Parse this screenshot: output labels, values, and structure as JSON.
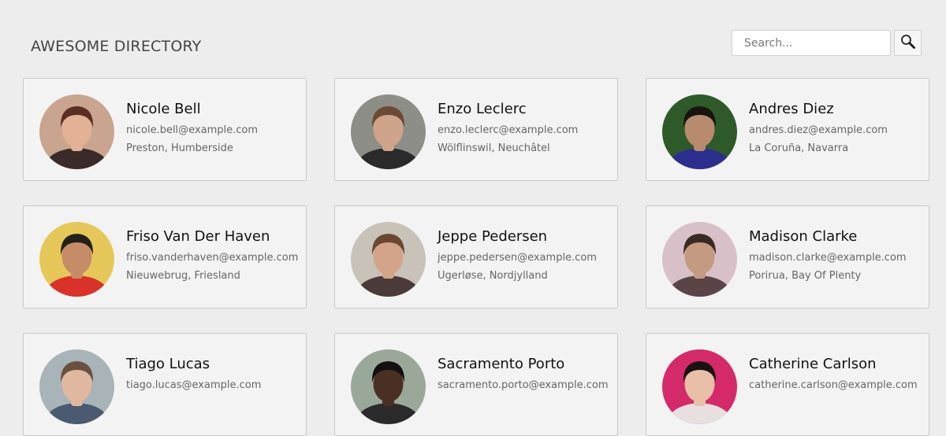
{
  "header": {
    "title": "AWESOME DIRECTORY"
  },
  "search": {
    "placeholder": "Search...",
    "value": "",
    "button_icon": "magnifying-glass-icon"
  },
  "people": [
    {
      "name": "Nicole Bell",
      "email": "nicole.bell@example.com",
      "location": "Preston, Humberside",
      "avatar": {
        "bg": "#c9a48e",
        "hair": "#5a2e22",
        "skin": "#e2b196",
        "shirt": "#3a2a2a"
      }
    },
    {
      "name": "Enzo Leclerc",
      "email": "enzo.leclerc@example.com",
      "location": "Wölflinswil, Neuchâtel",
      "avatar": {
        "bg": "#8e8e88",
        "hair": "#6a4a34",
        "skin": "#cfa48a",
        "shirt": "#2a2a2a"
      }
    },
    {
      "name": "Andres Diez",
      "email": "andres.diez@example.com",
      "location": "La Coruña, Navarra",
      "avatar": {
        "bg": "#2e5a2a",
        "hair": "#1a1410",
        "skin": "#b88a6e",
        "shirt": "#2c2e8e"
      }
    },
    {
      "name": "Friso Van Der Haven",
      "email": "friso.vanderhaven@example.com",
      "location": "Nieuwebrug, Friesland",
      "avatar": {
        "bg": "#e6c85a",
        "hair": "#24201c",
        "skin": "#c68c68",
        "shirt": "#d8322a"
      }
    },
    {
      "name": "Jeppe Pedersen",
      "email": "jeppe.pedersen@example.com",
      "location": "Ugerløse, Nordjylland",
      "avatar": {
        "bg": "#c8c2b8",
        "hair": "#6a4832",
        "skin": "#d4a48a",
        "shirt": "#4a3a3a"
      }
    },
    {
      "name": "Madison Clarke",
      "email": "madison.clarke@example.com",
      "location": "Porirua, Bay Of Plenty",
      "avatar": {
        "bg": "#d8c0c8",
        "hair": "#3a2a24",
        "skin": "#c49a80",
        "shirt": "#5a4448"
      }
    },
    {
      "name": "Tiago Lucas",
      "email": "tiago.lucas@example.com",
      "location": "",
      "avatar": {
        "bg": "#a8b4b8",
        "hair": "#6a5040",
        "skin": "#e0b8a0",
        "shirt": "#4a5a70"
      }
    },
    {
      "name": "Sacramento Porto",
      "email": "sacramento.porto@example.com",
      "location": "",
      "avatar": {
        "bg": "#9aa89a",
        "hair": "#141010",
        "skin": "#4a3024",
        "shirt": "#2a2a2a"
      }
    },
    {
      "name": "Catherine Carlson",
      "email": "catherine.carlson@example.com",
      "location": "",
      "avatar": {
        "bg": "#d42a6a",
        "hair": "#1a1212",
        "skin": "#e8c0a8",
        "shirt": "#e8e0e0"
      }
    }
  ]
}
